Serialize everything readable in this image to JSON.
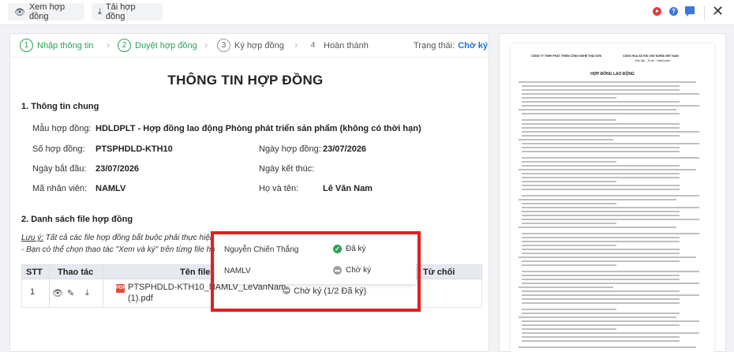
{
  "toolbar": {
    "view_label": "Xem hợp đồng",
    "download_label": "Tải hợp đồng"
  },
  "steps": [
    {
      "num": "1",
      "label": "Nhập thông tin"
    },
    {
      "num": "2",
      "label": "Duyệt hợp đồng"
    },
    {
      "num": "3",
      "label": "Ký hợp đồng"
    },
    {
      "num": "4",
      "label": "Hoàn thành"
    }
  ],
  "status": {
    "label": "Trạng thái:",
    "value": "Chờ ký"
  },
  "page_title": "THÔNG TIN HỢP ĐỒNG",
  "section1": "1. Thông tin chung",
  "fields": {
    "template_label": "Mẫu hợp đồng:",
    "template_value": "HDLDPLT - Hợp đồng lao động Phòng phát triển sản phẩm (không có thời hạn)",
    "number_label": "Số hợp đồng:",
    "number_value": "PTSPHDLD-KTH10",
    "date_label": "Ngày hợp đồng:",
    "date_value": "23/07/2026",
    "start_label": "Ngày bắt đầu:",
    "start_value": "23/07/2026",
    "end_label": "Ngày kết thúc:",
    "end_value": "",
    "emp_code_label": "Mã nhân viên:",
    "emp_code_value": "NAMLV",
    "name_label": "Họ và tên:",
    "name_value": "Lê Văn Nam"
  },
  "section2": "2. Danh sách file hợp đồng",
  "note": {
    "prefix": "Lưu ý:",
    "line1": " Tất cả các file hợp đồng bắt buộc phải thực hiện ký",
    "line2": "- Bạn có thể chọn thao tác \"Xem và ký\" trên từng file hợp đồng"
  },
  "table": {
    "headers": {
      "stt": "STT",
      "actions": "Thao tác",
      "file": "Tên file",
      "reject": "Từ chối"
    },
    "row": {
      "stt": "1",
      "file_line1": "PTSPHDLD-KTH10_NAMLV_LeVanNam",
      "file_line2": "(1).pdf",
      "status": "Chờ ký (1/2 Đã ký)"
    }
  },
  "popup": [
    {
      "name": "Nguyễn Chiến Thắng",
      "status": "Đã ký"
    },
    {
      "name": "NAMLV",
      "status": "Chờ ký"
    }
  ],
  "preview": {
    "company": "CÔNG TY TNHH PHÁT TRIỂN CÔNG NGHỆ THÁI SƠN",
    "country": "CỘNG HÒA XÃ HỘI CHỦ NGHĨA VIỆT NAM",
    "motto": "Độc lập - Tự do - Hạnh phúc",
    "doc_title": "HỢP ĐỒNG LAO ĐỘNG"
  }
}
